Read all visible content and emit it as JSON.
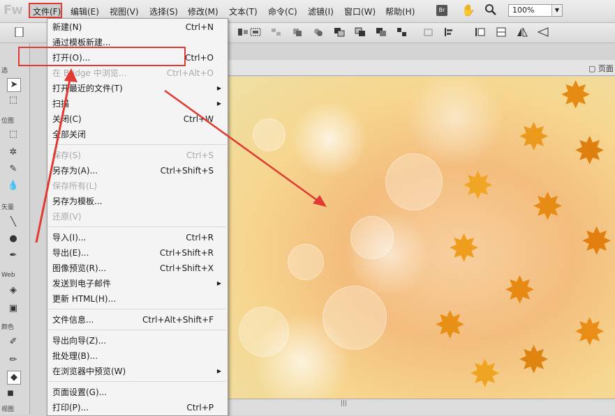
{
  "app": {
    "logo": "Fw"
  },
  "menubar": {
    "items": [
      "文件(F)",
      "编辑(E)",
      "视图(V)",
      "选择(S)",
      "修改(M)",
      "文本(T)",
      "命令(C)",
      "滤镜(I)",
      "窗口(W)",
      "帮助(H)"
    ],
    "bridge_button": "Br",
    "zoom_value": "100%"
  },
  "left_panel": {
    "labels": [
      "选",
      "位图",
      "矢量",
      "Web",
      "颜色",
      "视图"
    ]
  },
  "doc": {
    "page_label": "页面"
  },
  "file_menu": {
    "items": [
      {
        "label": "新建(N)",
        "shortcut": "Ctrl+N"
      },
      {
        "label": "通过模板新建...",
        "shortcut": ""
      },
      {
        "label": "打开(O)...",
        "shortcut": "Ctrl+O"
      },
      {
        "label": "在 Bridge 中浏览...",
        "shortcut": "Ctrl+Alt+O"
      },
      {
        "label": "打开最近的文件(T)",
        "shortcut": ""
      },
      {
        "label": "扫描",
        "shortcut": ""
      },
      {
        "label": "关闭(C)",
        "shortcut": "Ctrl+W"
      },
      {
        "label": "全部关闭",
        "shortcut": ""
      },
      {
        "label": "保存(S)",
        "shortcut": "Ctrl+S"
      },
      {
        "label": "另存为(A)...",
        "shortcut": "Ctrl+Shift+S"
      },
      {
        "label": "保存所有(L)",
        "shortcut": ""
      },
      {
        "label": "另存为模板...",
        "shortcut": ""
      },
      {
        "label": "还原(V)",
        "shortcut": ""
      },
      {
        "label": "导入(I)...",
        "shortcut": "Ctrl+R"
      },
      {
        "label": "导出(E)...",
        "shortcut": "Ctrl+Shift+R"
      },
      {
        "label": "图像预览(R)...",
        "shortcut": "Ctrl+Shift+X"
      },
      {
        "label": "发送到电子邮件",
        "shortcut": ""
      },
      {
        "label": "更新 HTML(H)...",
        "shortcut": ""
      },
      {
        "label": "文件信息...",
        "shortcut": "Ctrl+Alt+Shift+F"
      },
      {
        "label": "导出向导(Z)...",
        "shortcut": ""
      },
      {
        "label": "批处理(B)...",
        "shortcut": ""
      },
      {
        "label": "在浏览器中预览(W)",
        "shortcut": ""
      },
      {
        "label": "页面设置(G)...",
        "shortcut": ""
      },
      {
        "label": "打印(P)...",
        "shortcut": "Ctrl+P"
      }
    ]
  },
  "colors": {
    "highlight_red": "#e03a32",
    "menu_bg": "#f4f4f4",
    "disabled_text": "#a8a8a8"
  }
}
